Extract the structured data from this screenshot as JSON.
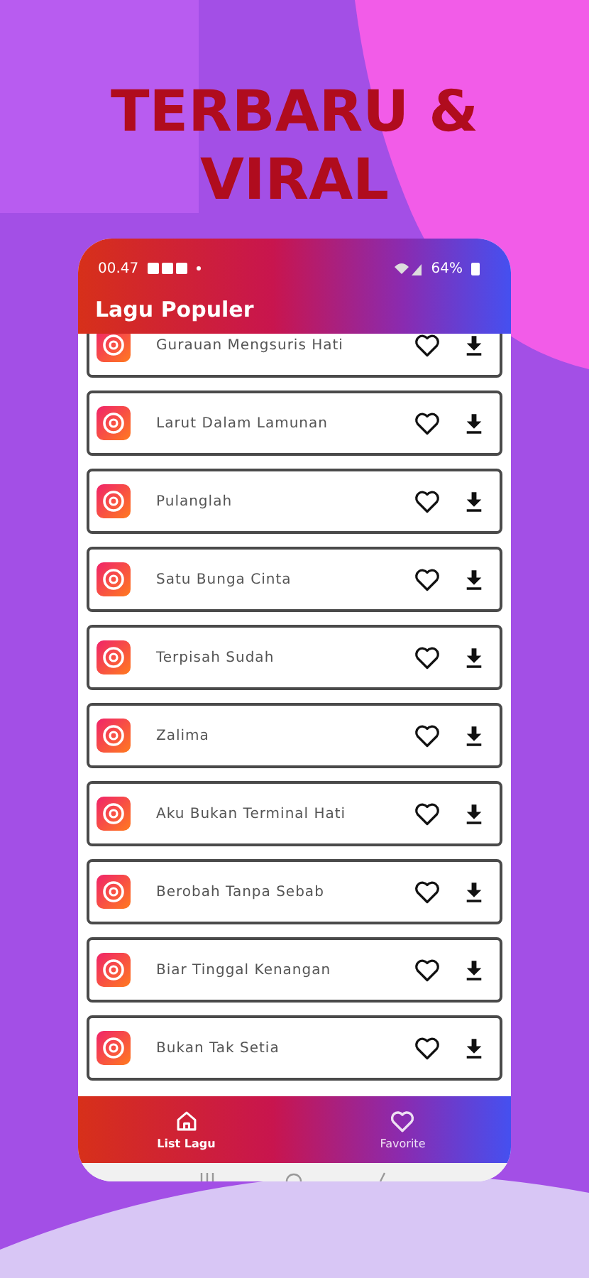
{
  "headline": [
    "TERBARU &",
    "VIRAL"
  ],
  "status_bar": {
    "time": "00.47",
    "battery": "64%"
  },
  "app_bar": {
    "title": "Lagu Populer"
  },
  "songs": [
    {
      "title": "Gurauan Mengsuris Hati",
      "favorite": false
    },
    {
      "title": "Larut Dalam Lamunan",
      "favorite": false
    },
    {
      "title": "Pulanglah",
      "favorite": false
    },
    {
      "title": "Satu Bunga Cinta",
      "favorite": false
    },
    {
      "title": "Terpisah Sudah",
      "favorite": false
    },
    {
      "title": "Zalima",
      "favorite": false
    },
    {
      "title": "Aku Bukan Terminal Hati",
      "favorite": false
    },
    {
      "title": "Berobah Tanpa Sebab",
      "favorite": false
    },
    {
      "title": "Biar Tinggal Kenangan",
      "favorite": false
    },
    {
      "title": "Bukan Tak Setia",
      "favorite": false
    }
  ],
  "bottom_nav": [
    {
      "label": "List Lagu",
      "kind": "home",
      "selected": true
    },
    {
      "label": "Favorite",
      "kind": "heart",
      "selected": false
    }
  ]
}
